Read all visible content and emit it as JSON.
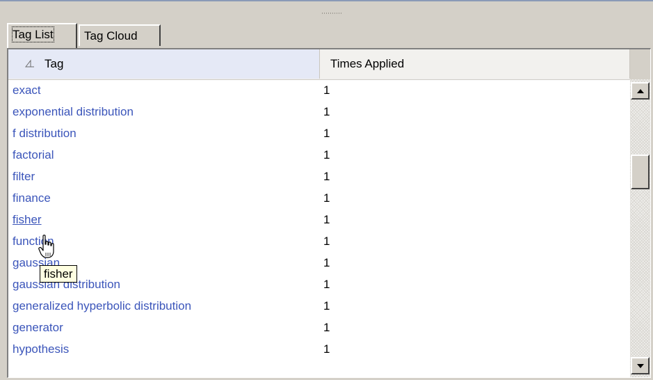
{
  "tabs": [
    {
      "label": "Tag List",
      "active": true
    },
    {
      "label": "Tag Cloud",
      "active": false
    }
  ],
  "table": {
    "columns": [
      "Tag",
      "Times Applied"
    ],
    "sort_icon": "sort-ascending-icon",
    "rows": [
      {
        "tag": "exact",
        "count": "1"
      },
      {
        "tag": "exponential distribution",
        "count": "1"
      },
      {
        "tag": "f distribution",
        "count": "1"
      },
      {
        "tag": "factorial",
        "count": "1"
      },
      {
        "tag": "filter",
        "count": "1"
      },
      {
        "tag": "finance",
        "count": "1"
      },
      {
        "tag": "fisher",
        "count": "1"
      },
      {
        "tag": "function",
        "count": "1"
      },
      {
        "tag": "gaussian",
        "count": "1"
      },
      {
        "tag": "gaussian distribution",
        "count": "1"
      },
      {
        "tag": "generalized hyperbolic distribution",
        "count": "1"
      },
      {
        "tag": "generator",
        "count": "1"
      },
      {
        "tag": "hypothesis",
        "count": "1"
      }
    ]
  },
  "tooltip": {
    "text": "fisher"
  },
  "cursor": {
    "icon": "hand-pointer-icon"
  },
  "colors": {
    "link": "#3b55ba",
    "tooltip_bg": "#ffffe1",
    "header_sorted_bg": "#e5e9f6"
  }
}
